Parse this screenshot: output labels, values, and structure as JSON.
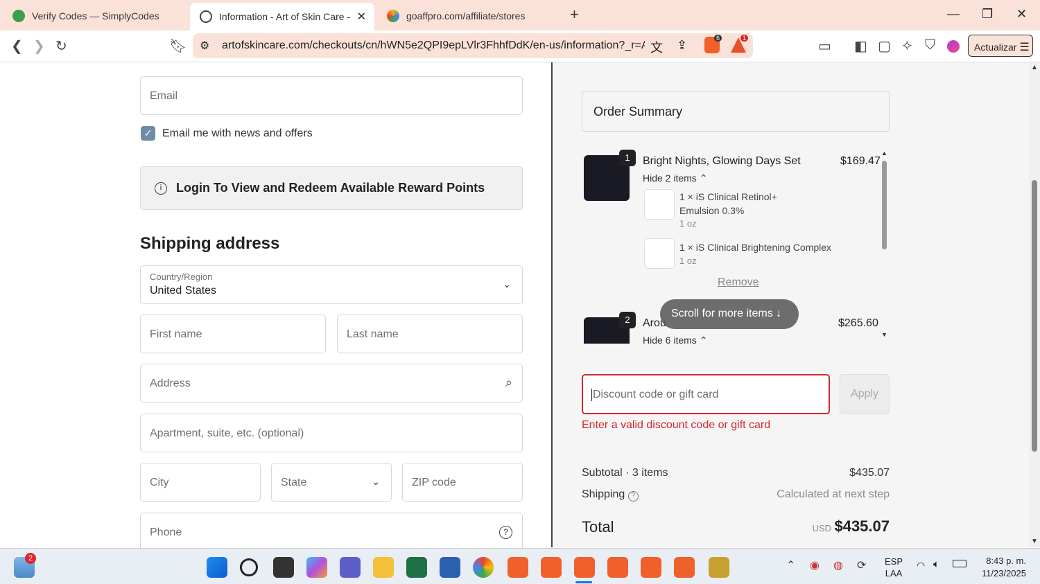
{
  "browser": {
    "tabs": [
      {
        "label": "Verify Codes — SimplyCodes"
      },
      {
        "label": "Information - Art of Skin Care - C"
      },
      {
        "label": "goaffpro.com/affiliate/stores"
      }
    ],
    "url": "artofskincare.com/checkouts/cn/hWN5e2QPI9epLVlr3FhhfDdK/en-us/information?_r=A...",
    "update_label": "Actualizar",
    "brave_badge": "6",
    "alert_badge": "1"
  },
  "form": {
    "email_placeholder": "Email",
    "news_label": "Email me with news and offers",
    "rewards_label": "Login To View and Redeem Available Reward Points",
    "shipping_heading": "Shipping address",
    "country_label": "Country/Region",
    "country_value": "United States",
    "first_name": "First name",
    "last_name": "Last name",
    "address": "Address",
    "apartment": "Apartment, suite, etc. (optional)",
    "city": "City",
    "state": "State",
    "zip": "ZIP code",
    "phone": "Phone"
  },
  "summary": {
    "title": "Order Summary",
    "item1": {
      "qty": "1",
      "name": "Bright Nights, Glowing Days Set",
      "price": "$169.47",
      "toggle": "Hide 2 items",
      "sub1_name": "1 × iS Clinical Retinol+ Emulsion 0.3%",
      "sub1_size": "1 oz",
      "sub2_name": "1 × iS Clinical Brightening Complex",
      "sub2_size": "1 oz",
      "remove": "Remove"
    },
    "item2": {
      "qty": "2",
      "name": "Arou",
      "price": "$265.60",
      "toggle": "Hide 6 items"
    },
    "scroll_hint": "Scroll for more items",
    "discount_placeholder": "Discount code or gift card",
    "apply": "Apply",
    "error": "Enter a valid discount code or gift card",
    "subtotal_label": "Subtotal · 3 items",
    "subtotal_value": "$435.07",
    "shipping_label": "Shipping",
    "shipping_value": "Calculated at next step",
    "total_label": "Total",
    "currency": "USD",
    "total_value": "$435.07"
  },
  "taskbar": {
    "widget_badge": "2",
    "lang": "ESP",
    "lang2": "LAA",
    "time": "8:43 p. m.",
    "date": "11/23/2025"
  }
}
